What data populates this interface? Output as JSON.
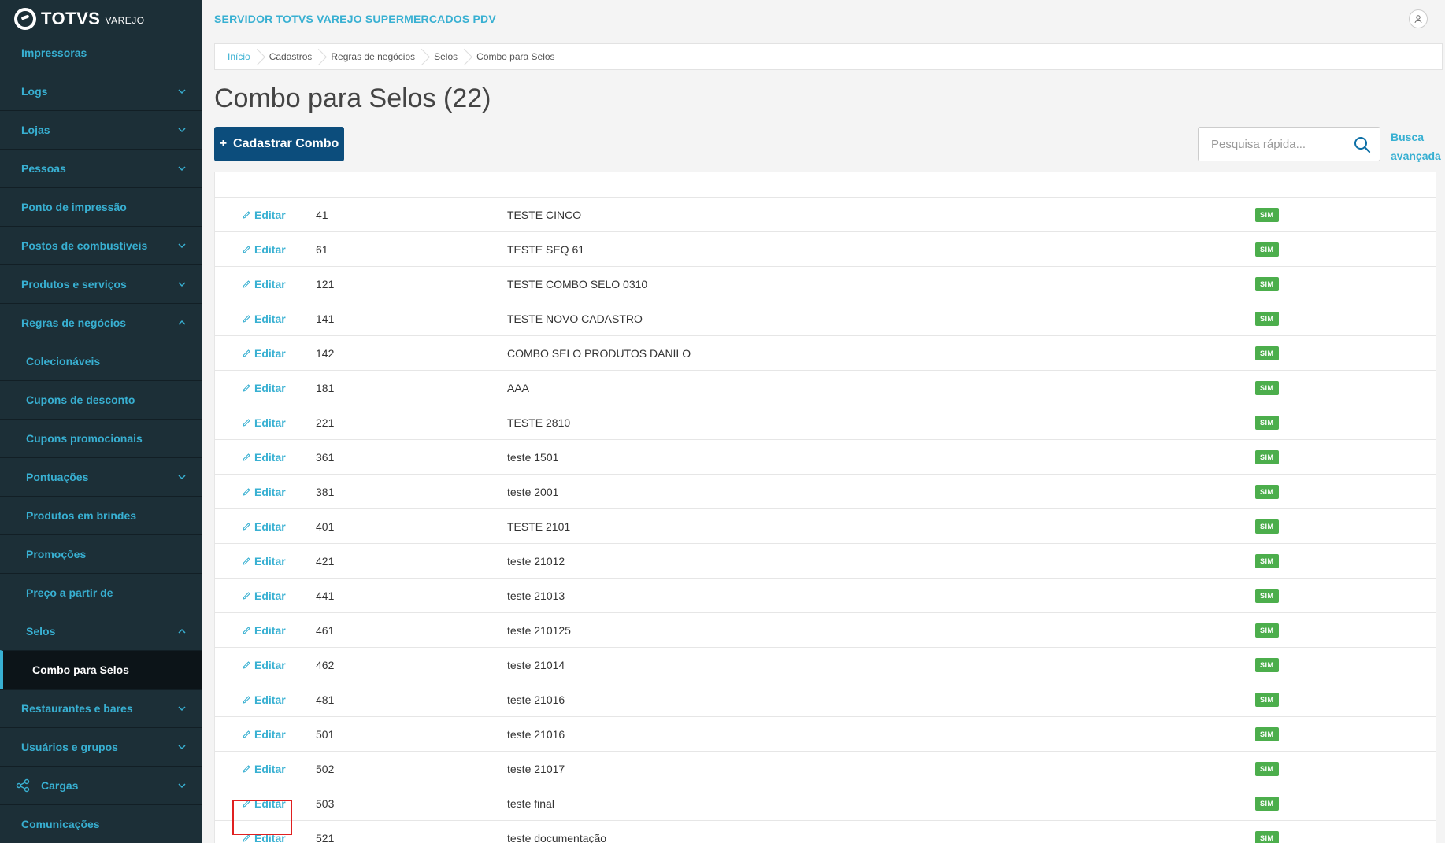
{
  "brand": {
    "name": "TOTVS",
    "sub": "VAREJO"
  },
  "header": {
    "server_title": "SERVIDOR TOTVS VAREJO SUPERMERCADOS PDV"
  },
  "sidebar": {
    "items": [
      {
        "label": "Impressoras",
        "chevron": ""
      },
      {
        "label": "Logs",
        "chevron": "down"
      },
      {
        "label": "Lojas",
        "chevron": "down"
      },
      {
        "label": "Pessoas",
        "chevron": "down"
      },
      {
        "label": "Ponto de impressão",
        "chevron": ""
      },
      {
        "label": "Postos de combustíveis",
        "chevron": "down"
      },
      {
        "label": "Produtos e serviços",
        "chevron": "down"
      },
      {
        "label": "Regras de negócios",
        "chevron": "up"
      },
      {
        "label": "Colecionáveis",
        "chevron": ""
      },
      {
        "label": "Cupons de desconto",
        "chevron": ""
      },
      {
        "label": "Cupons promocionais",
        "chevron": ""
      },
      {
        "label": "Pontuações",
        "chevron": "down"
      },
      {
        "label": "Produtos em brindes",
        "chevron": ""
      },
      {
        "label": "Promoções",
        "chevron": ""
      },
      {
        "label": "Preço a partir de",
        "chevron": ""
      },
      {
        "label": "Selos",
        "chevron": "up"
      },
      {
        "label": "Combo para Selos",
        "chevron": ""
      },
      {
        "label": "Restaurantes e bares",
        "chevron": "down"
      },
      {
        "label": "Usuários e grupos",
        "chevron": "down"
      },
      {
        "label": "Cargas",
        "chevron": "down"
      },
      {
        "label": "Comunicações",
        "chevron": ""
      }
    ]
  },
  "breadcrumb": [
    "Início",
    "Cadastros",
    "Regras de negócios",
    "Selos",
    "Combo para Selos"
  ],
  "page": {
    "title": "Combo para Selos (22)"
  },
  "toolbar": {
    "add_label": "Cadastrar Combo",
    "add_icon": "+",
    "search_placeholder": "Pesquisa rápida...",
    "advanced_search_line1": "Busca",
    "advanced_search_line2": "avançada"
  },
  "table": {
    "edit_label": "Editar",
    "rows": [
      {
        "code": "41",
        "description": "TESTE CINCO",
        "status": "SIM"
      },
      {
        "code": "61",
        "description": "TESTE SEQ 61",
        "status": "SIM"
      },
      {
        "code": "121",
        "description": "TESTE COMBO SELO 0310",
        "status": "SIM"
      },
      {
        "code": "141",
        "description": "TESTE NOVO CADASTRO",
        "status": "SIM"
      },
      {
        "code": "142",
        "description": "COMBO SELO PRODUTOS DANILO",
        "status": "SIM"
      },
      {
        "code": "181",
        "description": "AAA",
        "status": "SIM"
      },
      {
        "code": "221",
        "description": "TESTE 2810",
        "status": "SIM"
      },
      {
        "code": "361",
        "description": "teste 1501",
        "status": "SIM"
      },
      {
        "code": "381",
        "description": "teste 2001",
        "status": "SIM"
      },
      {
        "code": "401",
        "description": "TESTE 2101",
        "status": "SIM"
      },
      {
        "code": "421",
        "description": "teste 21012",
        "status": "SIM"
      },
      {
        "code": "441",
        "description": "teste 21013",
        "status": "SIM"
      },
      {
        "code": "461",
        "description": "teste 210125",
        "status": "SIM"
      },
      {
        "code": "462",
        "description": "teste 21014",
        "status": "SIM"
      },
      {
        "code": "481",
        "description": "teste 21016",
        "status": "SIM"
      },
      {
        "code": "501",
        "description": "teste 21016",
        "status": "SIM"
      },
      {
        "code": "502",
        "description": "teste 21017",
        "status": "SIM"
      },
      {
        "code": "503",
        "description": "teste final",
        "status": "SIM"
      },
      {
        "code": "521",
        "description": "teste documentação",
        "status": "SIM"
      }
    ]
  },
  "colors": {
    "accent": "#38b0d2",
    "sidebar_bg": "#1c2f37",
    "primary_button": "#0c4d7c",
    "badge_green": "#4cae4c",
    "highlight_red": "#e02020"
  }
}
